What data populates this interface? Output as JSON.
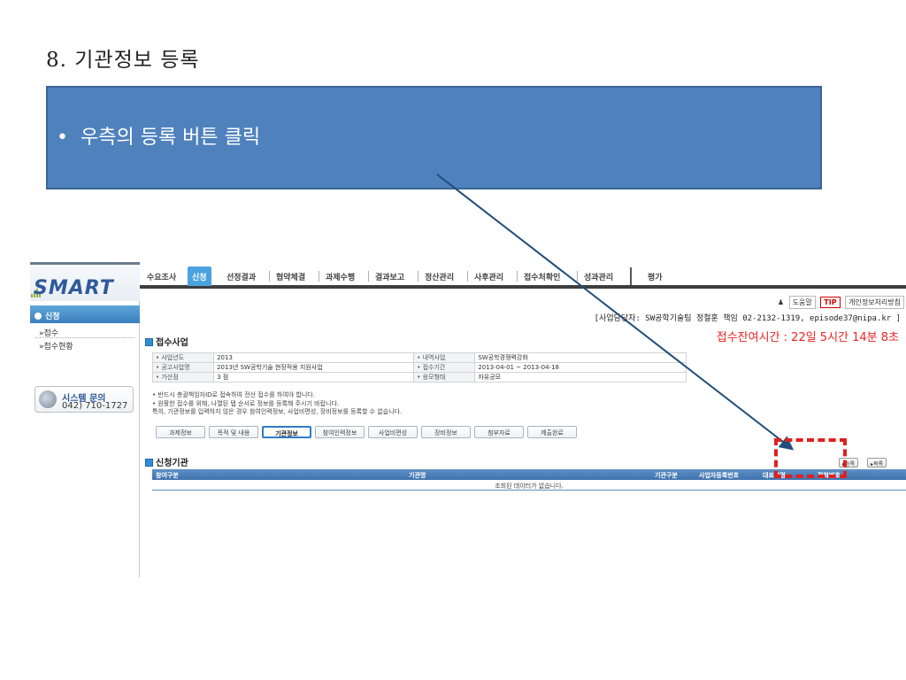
{
  "slide": {
    "title": "8.  기관정보 등록",
    "instruction": "우측의 등록 버튼 클릭",
    "bullet": "•"
  },
  "app": {
    "logo": "SMART",
    "top_nav": [
      "수요조사",
      "신청",
      "선정결과",
      "협약체결",
      "과제수행",
      "결과보고",
      "정산관리",
      "사후관리",
      "접수처확인",
      "성과관리",
      "평가"
    ],
    "active_nav": "신청"
  },
  "sidebar": {
    "header": "신청",
    "items": [
      "»접수",
      "»접수현황"
    ],
    "system_inquiry": {
      "title": "시스템 문의",
      "phone": "042) 710-1727"
    }
  },
  "utility": {
    "help": "도움말",
    "tip": "TIP",
    "privacy": "개인정보처리방침"
  },
  "manager_info": "[사업담당자: SW공학기술팀  정철훈 책임  02-2132-1319,  episode37@nipa.kr ]",
  "remaining_time": "접수잔여시간 : 22일 5시간 14분 8초",
  "application": {
    "section_title": "접수사업",
    "rows": [
      {
        "label1": "• 사업년도",
        "value1": "2013",
        "label2": "• 내역사업",
        "value2": "SW공학경쟁력강화"
      },
      {
        "label1": "• 공고사업명",
        "value1": "2013년 SW공학기술 현장적용 지원사업",
        "label2": "• 접수기간",
        "value2": "2013-04-01 ~ 2013-04-18"
      },
      {
        "label1": "• 가산점",
        "value1": "3 점",
        "label2": "• 응모형태",
        "value2": "자유공모"
      }
    ],
    "notes": [
      "• 반드시 총괄책임자ID로 접속하여 전산 접수를 하여야 합니다.",
      "• 원활한 접수를 위해, 나열된 탭 순서로 정보를 등록해 주시기 바랍니다.",
      "특히, 기관정보를 입력하지 않은 경우 참여인력정보, 사업비편성, 장비정보를 등록할 수 없습니다."
    ],
    "tabs": [
      "과제정보",
      "목적 및 내용",
      "기관정보",
      "참여인력정보",
      "사업비편성",
      "장비정보",
      "첨부자료",
      "제출완료"
    ],
    "active_tab": "기관정보"
  },
  "institution": {
    "section_title": "신청기관",
    "register_button": "▸등록",
    "list_button": "▸목록",
    "columns": [
      "참여구분",
      "기관명",
      "기관구분",
      "사업자등록번호",
      "대표자명",
      "전화번호"
    ],
    "empty_message": "조회된 데이터가 없습니다."
  },
  "colors": {
    "callout": "#4f81bd",
    "highlight": "#e02020",
    "arrow": "#1f4e79",
    "nav_active": "#4aa3de",
    "remain": "#e22222"
  }
}
